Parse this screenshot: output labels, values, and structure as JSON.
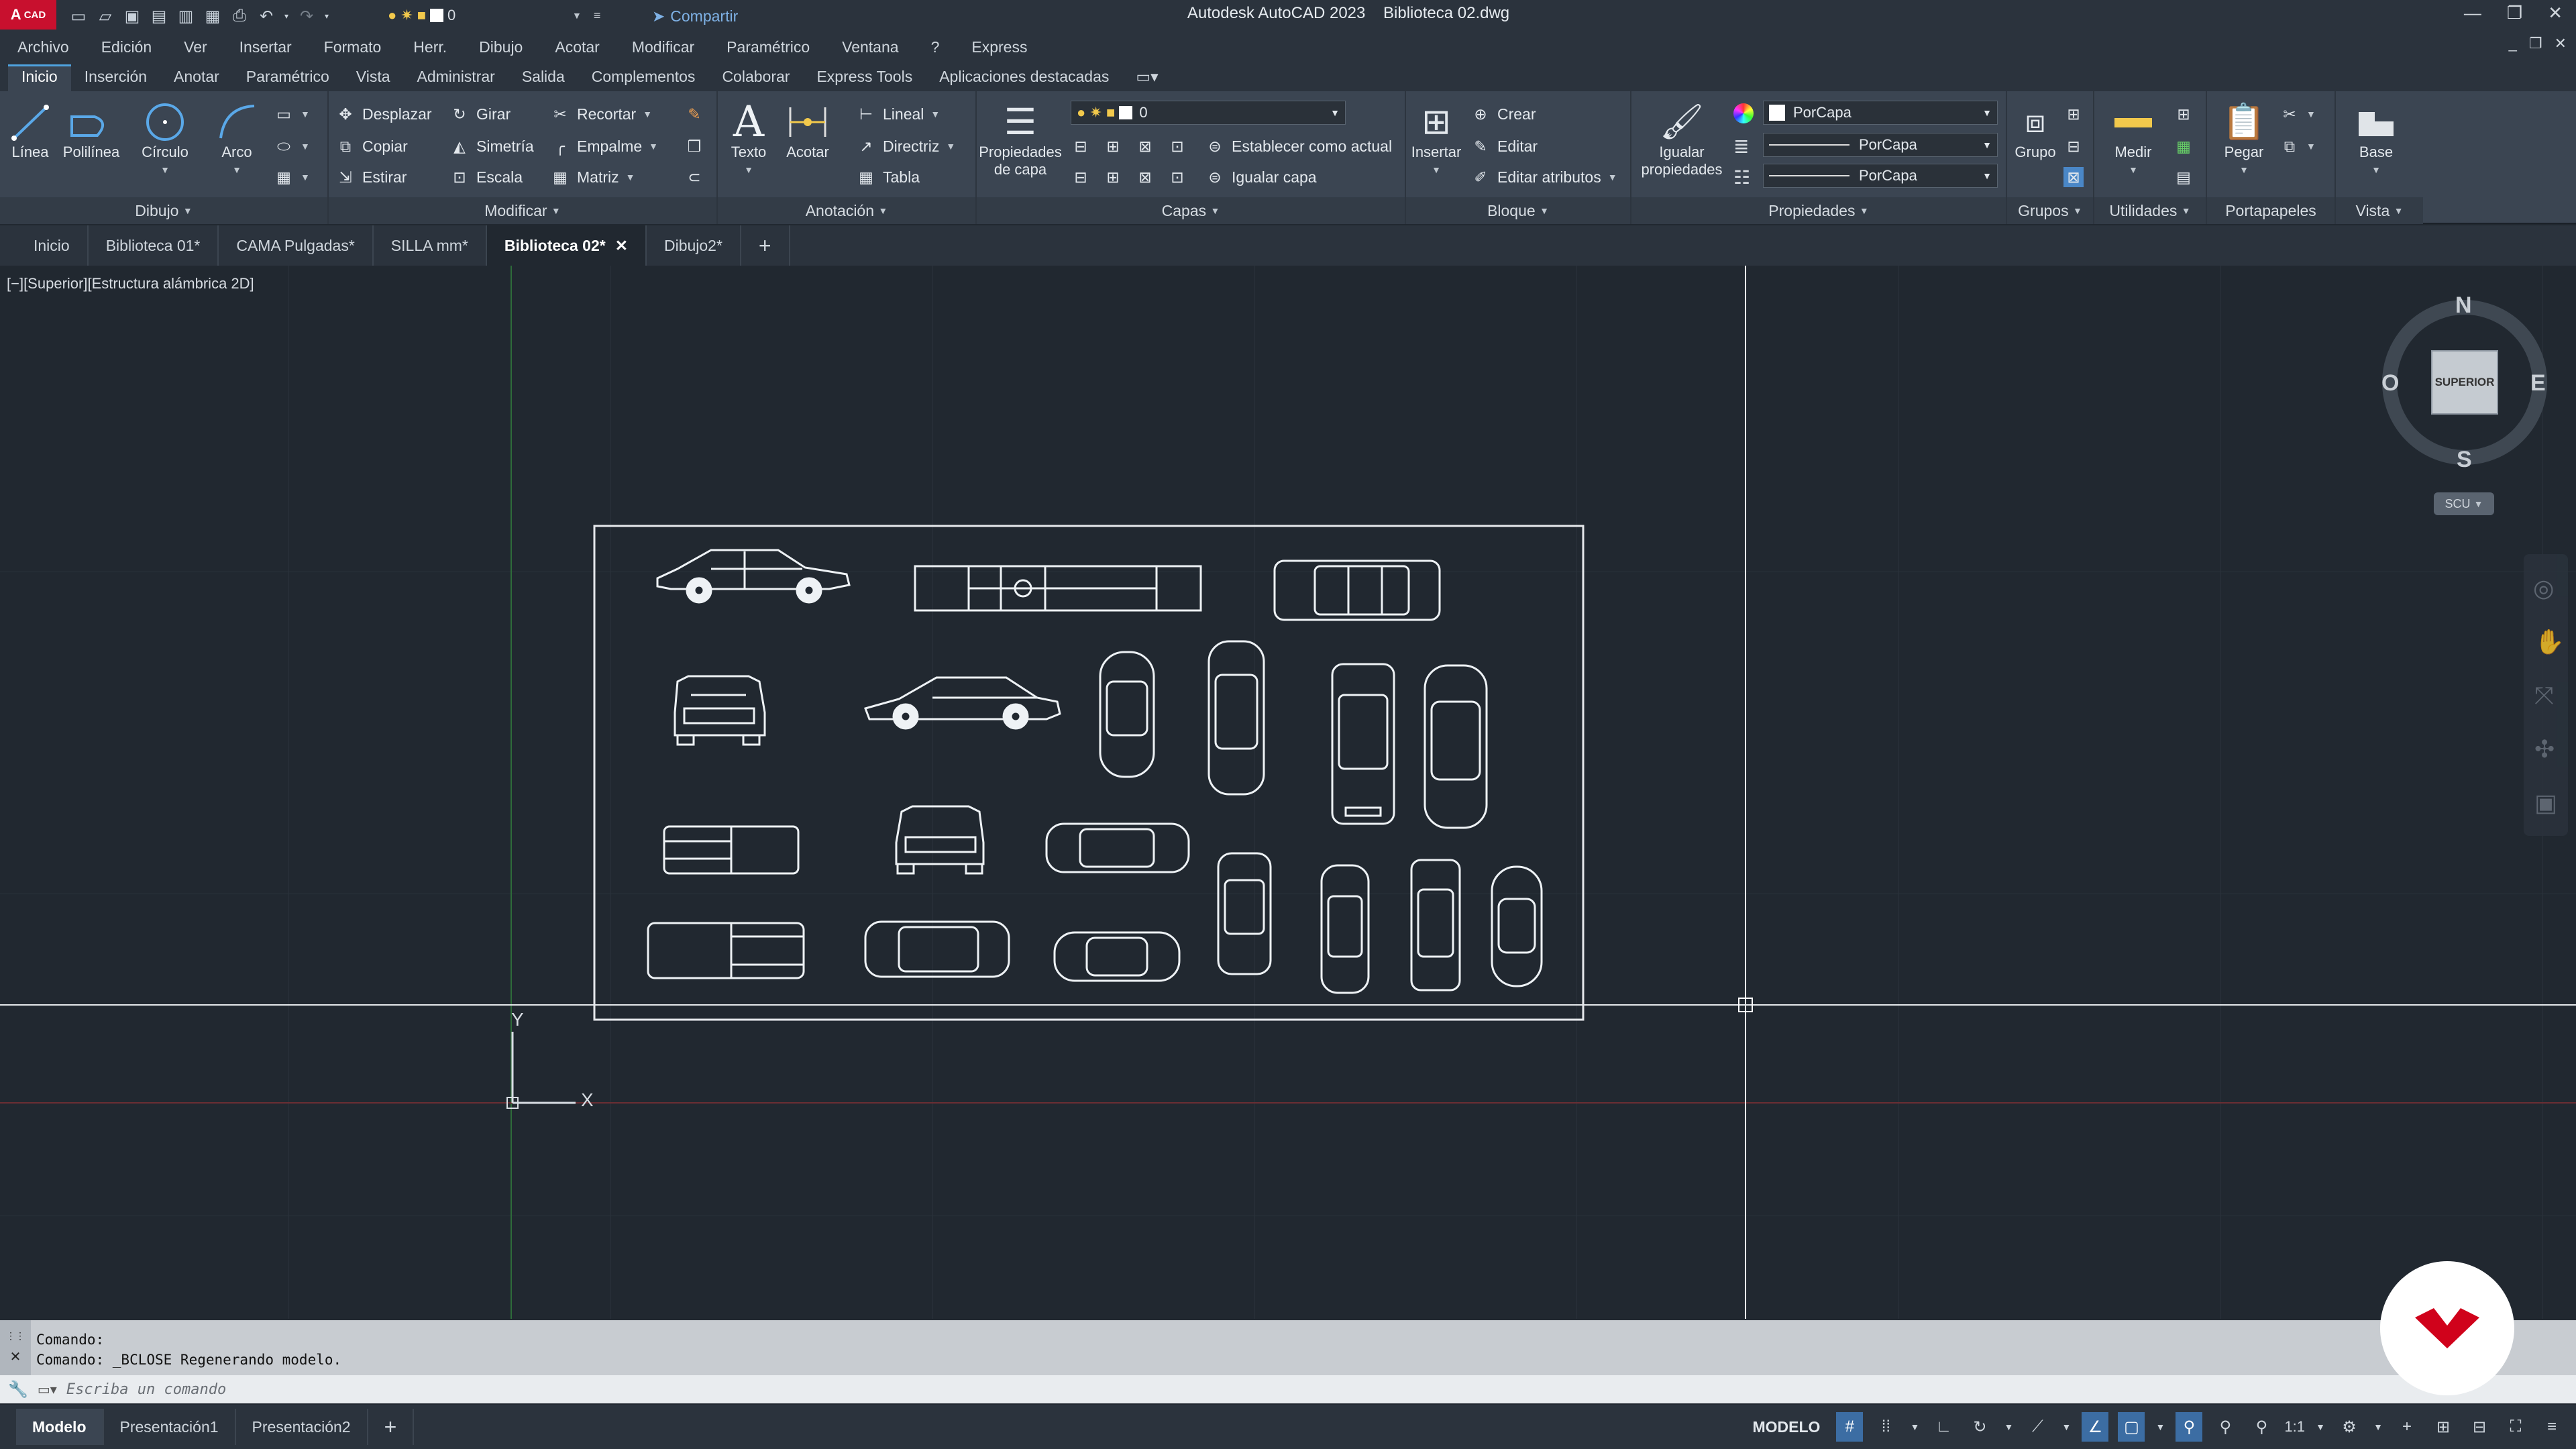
{
  "app": {
    "logo": "A",
    "logo_sub": "CAD",
    "title": "Autodesk AutoCAD 2023",
    "document": "Biblioteca 02.dwg",
    "share_label": "Compartir",
    "quick_layer": "0"
  },
  "menubar": {
    "items": [
      "Archivo",
      "Edición",
      "Ver",
      "Insertar",
      "Formato",
      "Herr.",
      "Dibujo",
      "Acotar",
      "Modificar",
      "Paramétrico",
      "Ventana",
      "?",
      "Express"
    ]
  },
  "ribbon_tabs": [
    "Inicio",
    "Inserción",
    "Anotar",
    "Paramétrico",
    "Vista",
    "Administrar",
    "Salida",
    "Complementos",
    "Colaborar",
    "Express Tools",
    "Aplicaciones destacadas"
  ],
  "ribbon": {
    "dibujo": {
      "title": "Dibujo",
      "linea": "Línea",
      "polilinea": "Polilínea",
      "circulo": "Círculo",
      "arco": "Arco"
    },
    "modificar": {
      "title": "Modificar",
      "desplazar": "Desplazar",
      "girar": "Girar",
      "recortar": "Recortar",
      "copiar": "Copiar",
      "simetria": "Simetría",
      "empalme": "Empalme",
      "estirar": "Estirar",
      "escala": "Escala",
      "matriz": "Matriz"
    },
    "anotacion": {
      "title": "Anotación",
      "texto": "Texto",
      "acotar": "Acotar",
      "lineal": "Lineal",
      "directriz": "Directriz",
      "tabla": "Tabla"
    },
    "capas": {
      "title": "Capas",
      "propiedades_l1": "Propiedades",
      "propiedades_l2": "de capa",
      "layer_value": "0",
      "establecer": "Establecer como actual",
      "igualar_capa": "Igualar capa"
    },
    "bloque": {
      "title": "Bloque",
      "insertar": "Insertar",
      "crear": "Crear",
      "editar": "Editar",
      "editar_atributos": "Editar atributos"
    },
    "propiedades": {
      "title": "Propiedades",
      "igualar_l1": "Igualar",
      "igualar_l2": "propiedades",
      "color": "PorCapa",
      "linetype": "PorCapa",
      "lineweight": "PorCapa"
    },
    "grupos": {
      "title": "Grupos",
      "grupo": "Grupo"
    },
    "utilidades": {
      "title": "Utilidades",
      "medir": "Medir"
    },
    "portapapeles": {
      "title": "Portapapeles",
      "pegar": "Pegar"
    },
    "vista": {
      "title": "Vista",
      "base": "Base"
    }
  },
  "doc_tabs": [
    {
      "label": "Inicio",
      "active": false
    },
    {
      "label": "Biblioteca 01*",
      "active": false
    },
    {
      "label": "CAMA Pulgadas*",
      "active": false
    },
    {
      "label": "SILLA mm*",
      "active": false
    },
    {
      "label": "Biblioteca 02*",
      "active": true
    },
    {
      "label": "Dibujo2*",
      "active": false
    }
  ],
  "viewport": {
    "label": "[−][Superior][Estructura alámbrica 2D]",
    "compass": {
      "n": "N",
      "s": "S",
      "e": "E",
      "w": "O",
      "face": "SUPERIOR"
    },
    "ucs_label": "SCU",
    "ucs_x": "X",
    "ucs_y": "Y"
  },
  "command": {
    "history": [
      "Comando:",
      "Comando:  _BCLOSE Regenerando modelo."
    ],
    "placeholder": "Escriba un comando"
  },
  "layout_tabs": [
    {
      "label": "Modelo",
      "active": true
    },
    {
      "label": "Presentación1",
      "active": false
    },
    {
      "label": "Presentación2",
      "active": false
    }
  ],
  "status": {
    "model": "MODELO",
    "scale": "1:1"
  },
  "colors": {
    "background": "#212830",
    "ribbon": "#3b4552",
    "accent": "#4fa3e0",
    "logo": "#c8102e",
    "brand": "#d0021b"
  }
}
